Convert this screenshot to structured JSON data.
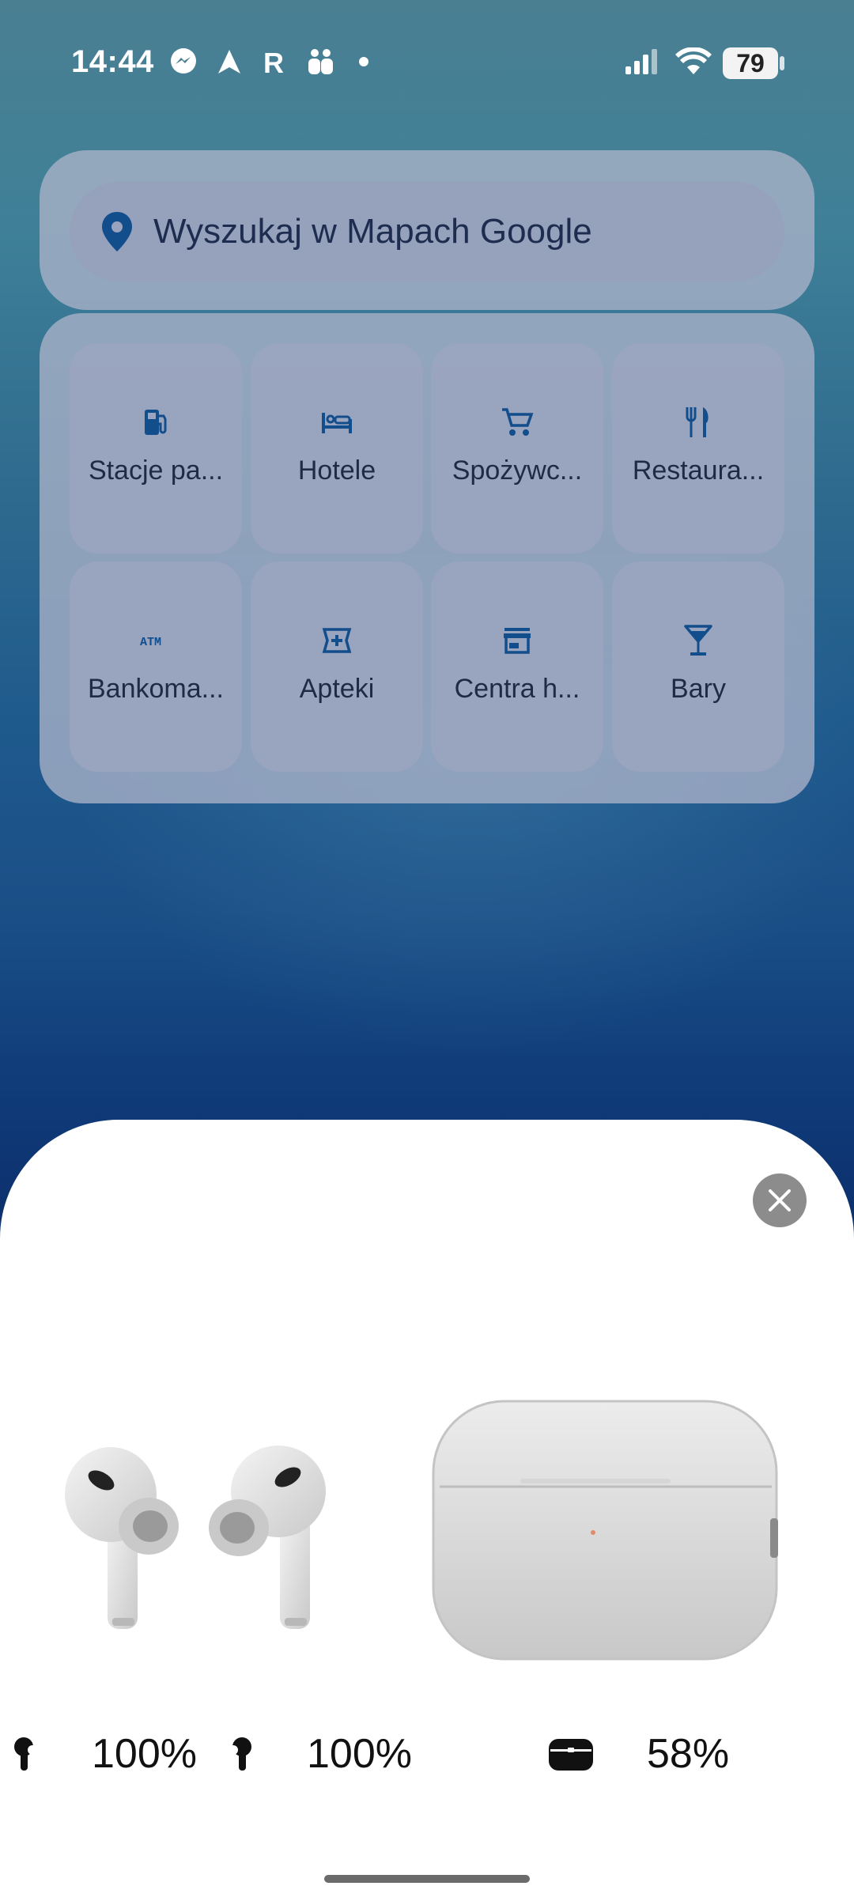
{
  "status_bar": {
    "time": "14:44",
    "battery_level": "79",
    "left_icons": [
      "messenger-icon",
      "navigation-arrow-icon",
      "r-app-icon",
      "family-link-icon",
      "dot-icon"
    ],
    "right_icons": [
      "signal-icon",
      "wifi-icon",
      "battery-icon"
    ]
  },
  "maps_widget": {
    "search_placeholder": "Wyszukaj w Mapach Google",
    "categories": [
      {
        "label": "Stacje pa...",
        "icon": "gas-station-icon"
      },
      {
        "label": "Hotele",
        "icon": "bed-icon"
      },
      {
        "label": "Spożywc...",
        "icon": "shopping-cart-icon"
      },
      {
        "label": "Restaura...",
        "icon": "fork-knife-icon"
      },
      {
        "label": "Bankoma...",
        "icon": "atm-icon"
      },
      {
        "label": "Apteki",
        "icon": "pharmacy-icon"
      },
      {
        "label": "Centra h...",
        "icon": "store-icon"
      },
      {
        "label": "Bary",
        "icon": "cocktail-icon"
      }
    ],
    "accent_color": "#124d8c"
  },
  "earbuds_popup": {
    "left_bud_level": "100%",
    "right_bud_level": "100%",
    "case_level": "58%",
    "close_icon": "close-icon"
  }
}
